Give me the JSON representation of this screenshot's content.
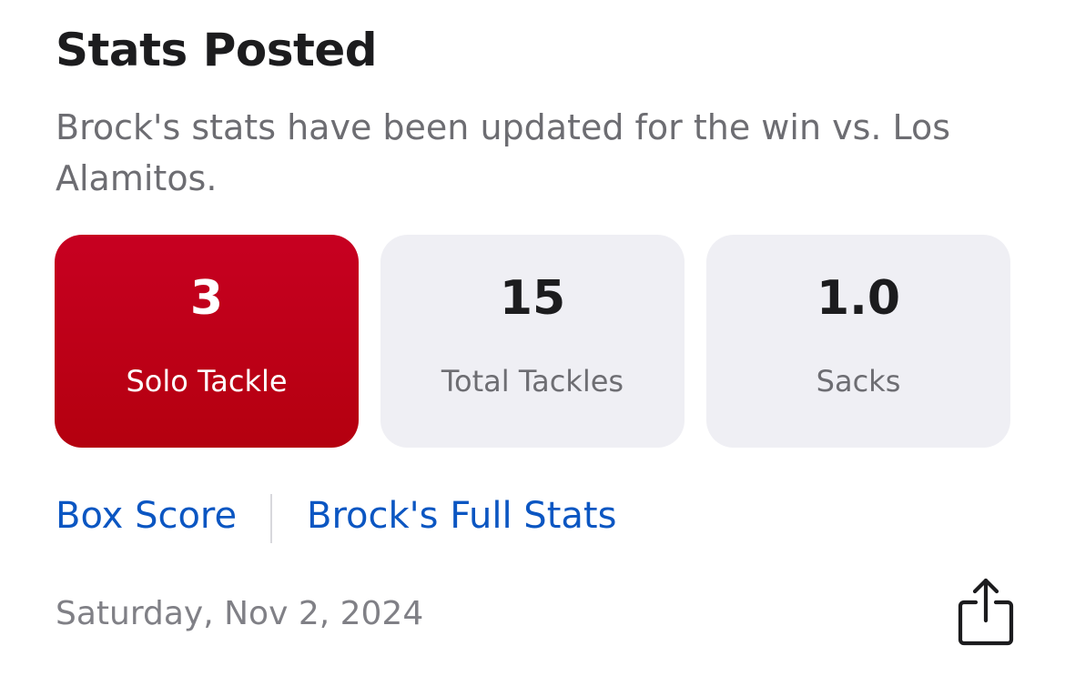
{
  "header": {
    "title": "Stats Posted",
    "subtitle": "Brock's stats have been updated for the win vs. Los Alamitos."
  },
  "stats": [
    {
      "value": "3",
      "label": "Solo Tackle",
      "highlighted": true
    },
    {
      "value": "15",
      "label": "Total Tackles",
      "highlighted": false
    },
    {
      "value": "1.0",
      "label": "Sacks",
      "highlighted": false
    }
  ],
  "links": {
    "box_score": "Box Score",
    "full_stats": "Brock's Full Stats"
  },
  "footer": {
    "date": "Saturday, Nov 2, 2024",
    "share_icon": "share-icon"
  },
  "colors": {
    "highlight_card": "#c0001a",
    "card_bg": "#efeff4",
    "link": "#0b56c2",
    "secondary_text": "#6d6d72"
  }
}
